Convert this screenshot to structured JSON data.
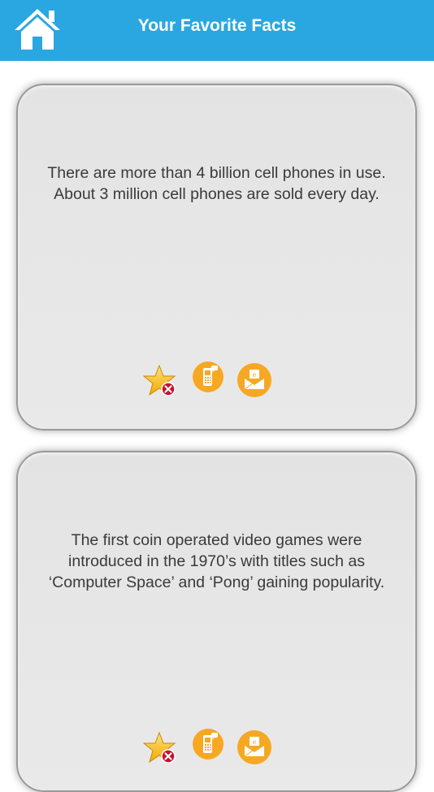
{
  "header": {
    "title": "Your Favorite Facts",
    "home_icon": "home-icon",
    "background_color": "#2aa7e0"
  },
  "facts": [
    {
      "text_line1": "There are more than 4 billion cell phones in use.",
      "text_line2": "About 3 million cell phones are sold every day.",
      "text_line3": "",
      "actions": [
        "unfavorite-star-icon",
        "sms-phone-icon",
        "email-envelope-icon"
      ]
    },
    {
      "text_line1": "The first coin operated video games were",
      "text_line2": "introduced in the 1970’s with titles such as",
      "text_line3": "‘Computer Space’ and ‘Pong’ gaining popularity.",
      "actions": [
        "unfavorite-star-icon",
        "sms-phone-icon",
        "email-envelope-icon"
      ]
    }
  ],
  "colors": {
    "accent_orange": "#f7a823",
    "card_background": "#e6e6e6",
    "remove_badge": "#c8102e"
  }
}
